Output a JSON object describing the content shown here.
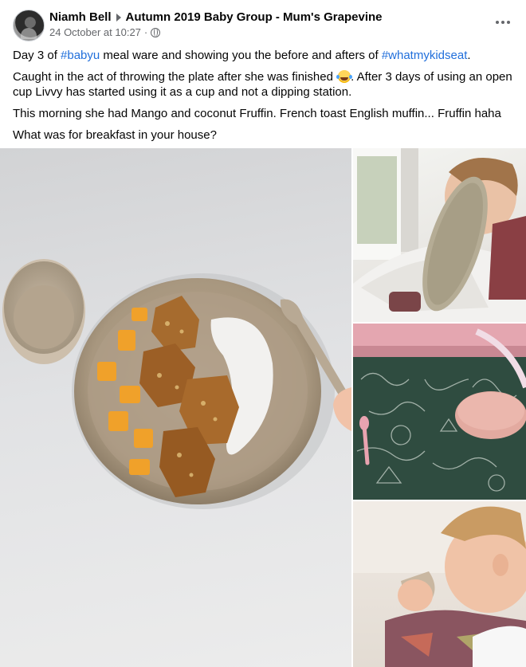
{
  "author": {
    "name": "Niamh Bell",
    "avatar_icon": "profile-photo"
  },
  "group": {
    "name": "Autumn 2019 Baby Group - Mum's Grapevine"
  },
  "meta": {
    "timestamp": "24 October at 10:27",
    "separator": "·",
    "privacy_icon": "globe-icon"
  },
  "menu_icon": "more-options-icon",
  "content": {
    "p1_a": "Day 3 of ",
    "p1_tag1": "#babyu",
    "p1_b": " meal ware and showing you the before and afters of ",
    "p1_tag2": "#whatmykidseat",
    "p1_c": ".",
    "p2_a": "Caught in the act of throwing the plate after she was finished",
    "p2_emoji": "tears-of-joy-emoji",
    "p2_b": ". After 3 days of using an open cup Livvy has started using it as a cup and not a dipping station.",
    "p3": "This morning she had Mango and coconut Fruffin. French toast English muffin... Fruffin haha",
    "p4": "What was for breakfast in your house?"
  },
  "photos": [
    {
      "name": "photo-plate-before"
    },
    {
      "name": "photo-throwing-plate"
    },
    {
      "name": "photo-empty-plate"
    },
    {
      "name": "photo-drinking-cup"
    }
  ],
  "colors": {
    "link": "#216fdb",
    "secondary_text": "#65676b"
  }
}
